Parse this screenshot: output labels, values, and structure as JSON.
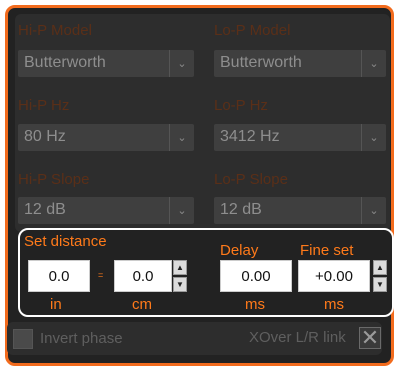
{
  "hip": {
    "model_label": "Hi-P Model",
    "model_value": "Butterworth",
    "hz_label": "Hi-P Hz",
    "hz_value": "80 Hz",
    "slope_label": "Hi-P Slope",
    "slope_value": "12 dB"
  },
  "lop": {
    "model_label": "Lo-P Model",
    "model_value": "Butterworth",
    "hz_label": "Lo-P Hz",
    "hz_value": "3412 Hz",
    "slope_label": "Lo-P Slope",
    "slope_value": "12 dB"
  },
  "distance": {
    "title": "Set distance",
    "in_value": "0.0",
    "in_unit": "in",
    "cm_value": "0.0",
    "cm_unit": "cm",
    "equals_symbol": "="
  },
  "delay": {
    "title": "Delay",
    "value": "0.00",
    "unit": "ms"
  },
  "fine": {
    "title": "Fine set",
    "value": "+0.00",
    "unit": "ms"
  },
  "options": {
    "invert_phase_label": "Invert phase",
    "invert_phase_checked": false,
    "xover_link_label": "XOver L/R link",
    "xover_link_checked": true
  },
  "colors": {
    "accent": "#ff7a1a",
    "border": "#f26b1d",
    "disabled_label": "#5a2f18",
    "background": "#222222"
  }
}
